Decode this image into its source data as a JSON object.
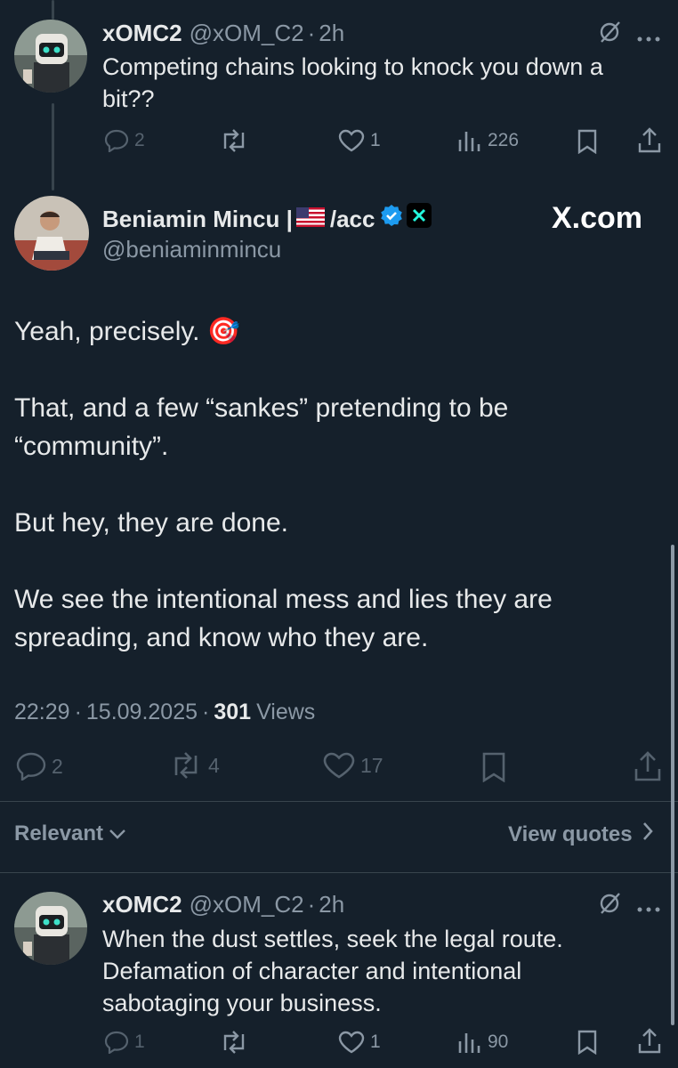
{
  "reply_top": {
    "display_name": "xOMC2",
    "handle": "@xOM_C2",
    "time": "2h",
    "text": "Competing chains looking to knock you down a bit??",
    "replies": "2",
    "reposts": "",
    "likes": "1",
    "views": "226"
  },
  "main_post": {
    "display_name": "Beniamin Mincu |",
    "name_suffix": "/acc",
    "handle": "@beniaminmincu",
    "watermark": "X.com",
    "paragraphs": [
      "Yeah, precisely. 🎯",
      "That, and a few “sankes” pretending to be “community”.",
      "But hey, they are done.",
      "We see the intentional mess and lies they are spreading, and know who they are."
    ],
    "time": "22:29",
    "date": "15.09.2025",
    "views_count": "301",
    "views_label": "Views",
    "replies": "2",
    "reposts": "4",
    "likes": "17"
  },
  "sort_bar": {
    "sort_label": "Relevant",
    "quotes_label": "View quotes"
  },
  "reply_bottom": {
    "display_name": "xOMC2",
    "handle": "@xOM_C2",
    "time": "2h",
    "text": "When the dust settles, seek the legal route. Defamation of character and intentional sabotaging your business.",
    "replies": "1",
    "reposts": "",
    "likes": "1",
    "views": "90"
  },
  "colors": {
    "background": "#15202b",
    "text": "#e7e9ea",
    "muted": "#8b98a5",
    "verified": "#1d9bf0",
    "divider": "#38444d"
  },
  "icons": [
    "reply-icon",
    "repost-icon",
    "like-icon",
    "views-icon",
    "bookmark-icon",
    "share-icon",
    "grok-icon",
    "more-icon",
    "verified-badge-icon",
    "us-flag-icon",
    "project-logo-icon",
    "chevron-down-icon",
    "chevron-right-icon"
  ]
}
